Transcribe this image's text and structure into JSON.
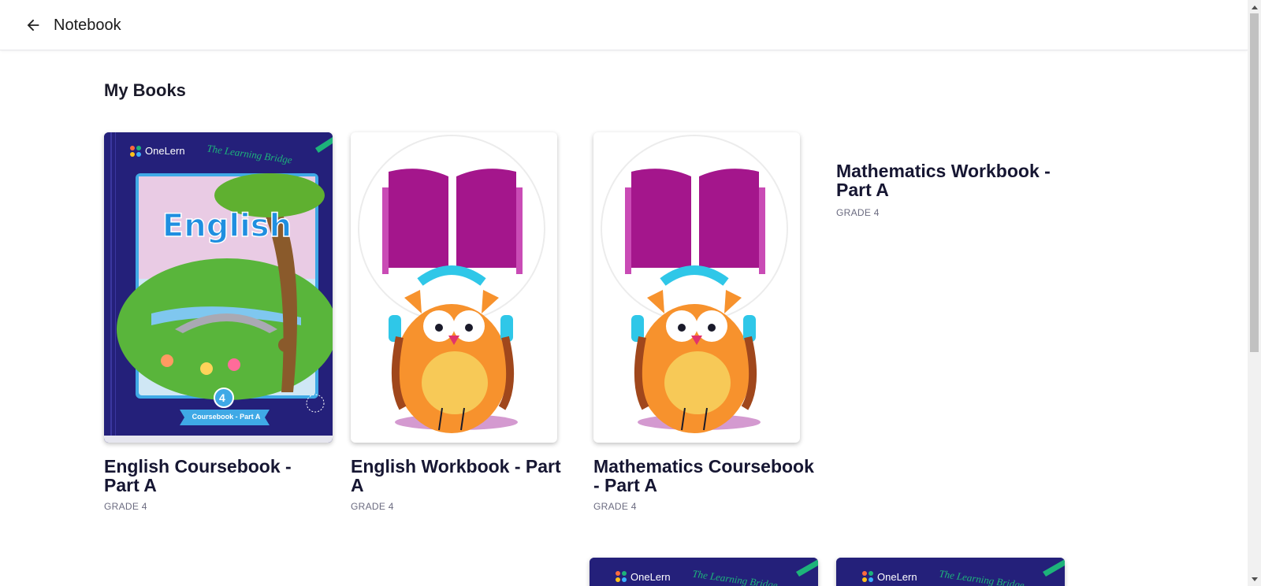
{
  "header": {
    "title": "Notebook"
  },
  "section": {
    "title": "My Books"
  },
  "books": [
    {
      "title": "English Coursebook - Part A",
      "grade": "GRADE 4",
      "cover": {
        "brand": "OneLern",
        "tagline": "The Learning Bridge",
        "subject": "English",
        "badge": "4",
        "label": "Coursebook - Part A"
      }
    },
    {
      "title": "English Workbook - Part A",
      "grade": "GRADE 4",
      "cover": "owl-reading-icon"
    },
    {
      "title": "Mathematics Coursebook - Part A",
      "grade": "GRADE 4",
      "cover": "owl-reading-icon"
    },
    {
      "title": "Mathematics Workbook - Part A",
      "grade": "GRADE 4"
    }
  ],
  "next_row": [
    {
      "brand": "OneLern",
      "tagline": "The Learning Bridge"
    },
    {
      "brand": "OneLern",
      "tagline": "The Learning Bridge"
    }
  ],
  "colors": {
    "cover_navy": "#24207a",
    "accent_green": "#1db37a",
    "book_magenta": "#a4168c",
    "owl_orange": "#f7922d"
  }
}
